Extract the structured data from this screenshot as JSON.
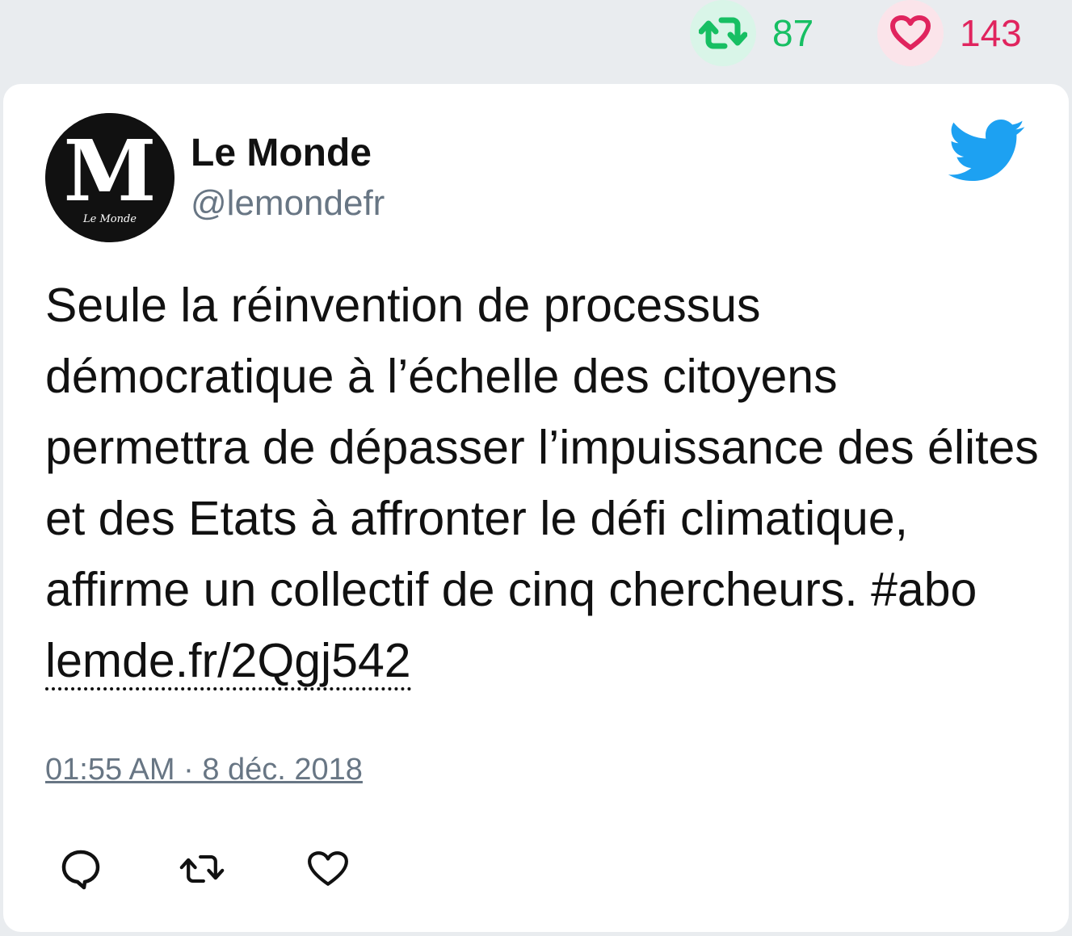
{
  "top_stats": {
    "retweet_count": "87",
    "like_count": "143",
    "retweet_color": "#17bf63",
    "like_color": "#e0245e"
  },
  "tweet": {
    "author_name": "Le Monde",
    "author_handle": "@lemondefr",
    "avatar_logo_text": "M",
    "avatar_logo_subtext": "Le Monde",
    "text_before_link": "Seule la réinvention de processus démocratique à l’échelle des citoyens permettra de dépasser l’impuissance des élites et des Etats à affronter le défi climatique, affirme un collectif de cinq chercheurs. #abo ",
    "link_text": "lemde.fr/2Qgj542",
    "timestamp": "01:55 AM · 8 déc. 2018"
  },
  "icons": {
    "retweet": "retweet-icon",
    "like": "heart-icon",
    "reply": "reply-icon",
    "brand": "twitter-bird-icon"
  },
  "colors": {
    "twitter_blue": "#1da1f2",
    "handle_gray": "#687684"
  }
}
